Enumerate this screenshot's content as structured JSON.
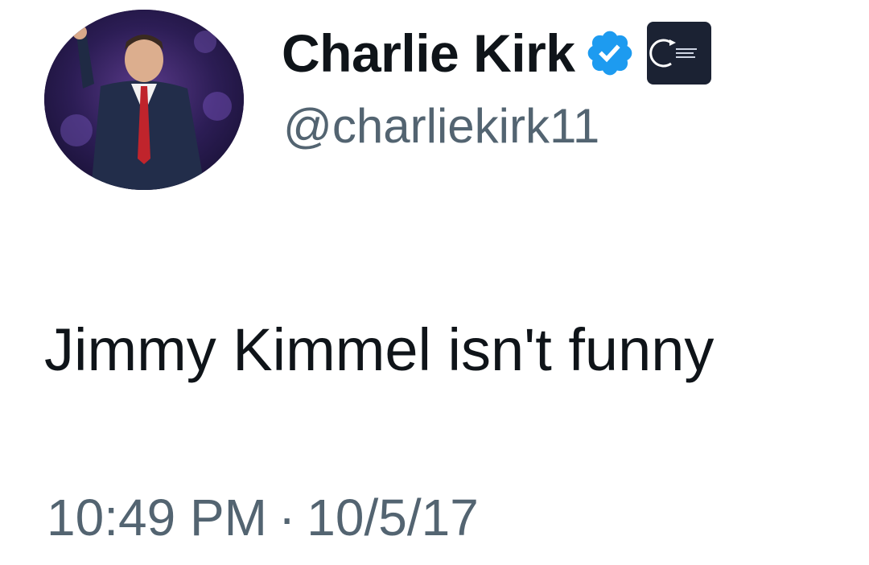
{
  "author": {
    "display_name": "Charlie Kirk",
    "handle": "@charliekirk11",
    "verified_icon": "verified-badge-icon",
    "affiliate_badge_icon": "turning-point-usa-logo"
  },
  "tweet": {
    "text": "Jimmy Kimmel isn't funny",
    "time": "10:49 PM",
    "separator": "·",
    "date": "10/5/17"
  },
  "colors": {
    "verified_blue": "#1d9bf0",
    "text_primary": "#0f1419",
    "text_secondary": "#536471",
    "badge_bg": "#1b2233"
  }
}
